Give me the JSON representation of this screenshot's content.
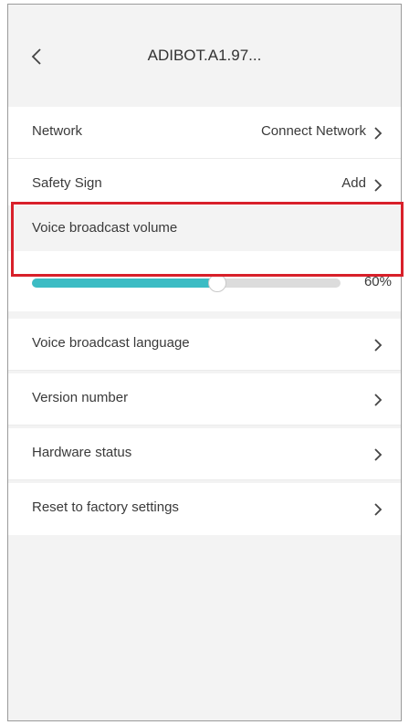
{
  "header": {
    "title": "ADIBOT.A1.97...",
    "back_icon": "chevron-left-icon"
  },
  "rows": [
    {
      "label": "Network",
      "value": "Connect Network"
    },
    {
      "label": "Safety Sign",
      "value": "Add"
    }
  ],
  "volume": {
    "label": "Voice broadcast volume",
    "percent_text": "60%",
    "level": 0.6,
    "fill_color": "#3cbcc4"
  },
  "menu": [
    {
      "label": "Voice broadcast language"
    },
    {
      "label": "Version number"
    },
    {
      "label": "Hardware status"
    },
    {
      "label": "Reset to factory settings"
    }
  ],
  "highlight_color": "#d8202a"
}
